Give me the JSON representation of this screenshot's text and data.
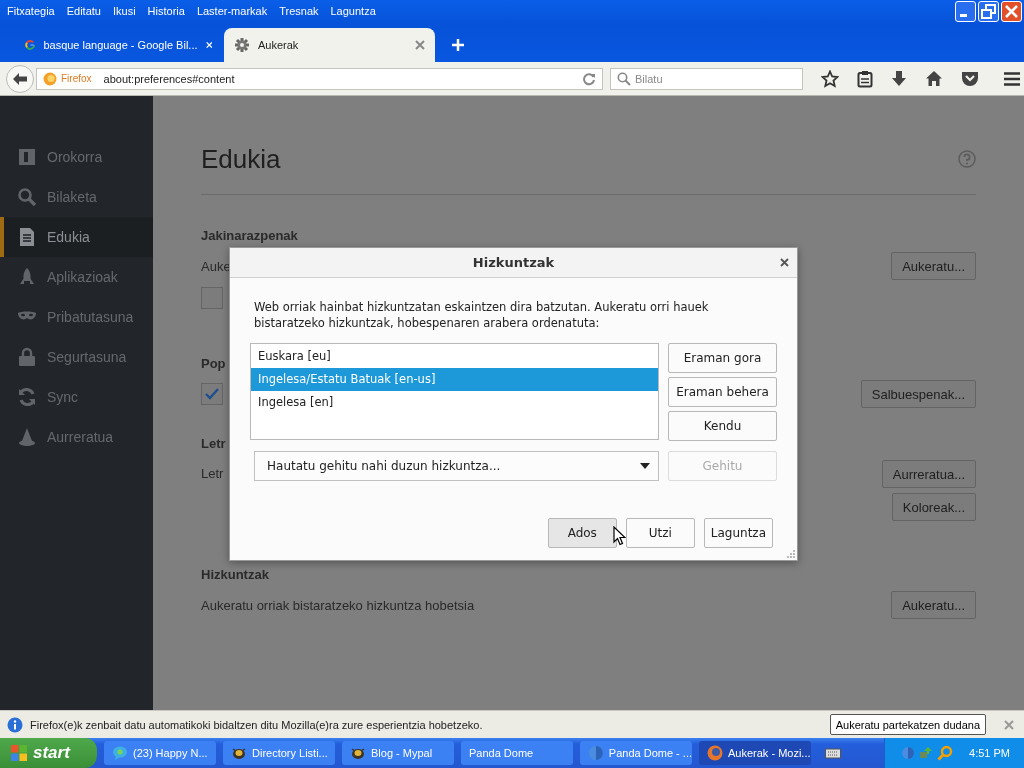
{
  "menu": [
    {
      "label": "Fitxategia"
    },
    {
      "label": "Editatu"
    },
    {
      "label": "Ikusi"
    },
    {
      "label": "Historia"
    },
    {
      "label": "Laster-markak"
    },
    {
      "label": "Tresnak"
    },
    {
      "label": "Laguntza"
    }
  ],
  "tabs": [
    {
      "title": "basque language - Google Bil...",
      "kind": "google",
      "selected": false
    },
    {
      "title": "Aukerak",
      "kind": "gear",
      "selected": true
    }
  ],
  "navbar": {
    "identity": "Firefox",
    "url": "about:preferences#content",
    "search_placeholder": "Bilatu"
  },
  "sidebar": [
    {
      "label": "Orokorra",
      "kind": "general",
      "selected": false
    },
    {
      "label": "Bilaketa",
      "kind": "search",
      "selected": false
    },
    {
      "label": "Edukia",
      "kind": "content",
      "selected": true
    },
    {
      "label": "Aplikazioak",
      "kind": "apps",
      "selected": false
    },
    {
      "label": "Pribatutasuna",
      "kind": "mask",
      "selected": false
    },
    {
      "label": "Segurtasuna",
      "kind": "lock",
      "selected": false
    },
    {
      "label": "Sync",
      "kind": "sync",
      "selected": false
    },
    {
      "label": "Aurreratua",
      "kind": "wizard",
      "selected": false
    }
  ],
  "page": {
    "title": "Edukia",
    "notifications": {
      "heading": "Jakinarazpenak",
      "text": "Auke",
      "button": "Aukeratu...",
      "checked": false
    },
    "popups": {
      "heading": "Pop",
      "checked": true,
      "button": "Salbuespenak..."
    },
    "fonts": {
      "heading": "Letr",
      "text": "Letr",
      "buttons": [
        "Aurreratua...",
        "Koloreak..."
      ]
    },
    "languages": {
      "heading": "Hizkuntzak",
      "text": "Aukeratu orriak bistaratzeko hizkuntza hobetsia",
      "button": "Aukeratu..."
    }
  },
  "dialog": {
    "title": "Hizkuntzak",
    "description": "Web orriak hainbat hizkuntzatan eskaintzen dira batzutan. Aukeratu orri hauek bistaratzeko hizkuntzak, hobespenaren arabera ordenatuta:",
    "languages": [
      {
        "label": "Euskara  [eu]",
        "selected": false
      },
      {
        "label": "Ingelesa/Estatu Batuak  [en-us]",
        "selected": true
      },
      {
        "label": "Ingelesa  [en]",
        "selected": false
      }
    ],
    "side_buttons": [
      "Eraman gora",
      "Eraman behera",
      "Kendu"
    ],
    "picker_placeholder": "Hautatu gehitu nahi duzun hizkuntza...",
    "add_button": {
      "label": "Gehitu",
      "disabled": true
    },
    "buttons": [
      {
        "label": "Ados",
        "hovered": true
      },
      {
        "label": "Utzi",
        "hovered": false
      },
      {
        "label": "Laguntza",
        "hovered": false
      }
    ]
  },
  "notification_bar": {
    "text": "Firefox(e)k zenbait datu automatikoki bidaltzen ditu Mozilla(e)ra zure esperientzia hobetzeko.",
    "button": "Aukeratu partekatzen dudana"
  },
  "taskbar": {
    "start": "start",
    "tasks": [
      {
        "label": "(23) Happy N...",
        "kind": "bubble",
        "active": false
      },
      {
        "label": "Directory Listi...",
        "kind": "critter",
        "active": false
      },
      {
        "label": "Blog - Mypal",
        "kind": "critter",
        "active": false
      },
      {
        "label": "Panda Dome",
        "kind": "plain",
        "active": false
      },
      {
        "label": "Panda Dome - ...",
        "kind": "globe",
        "active": false
      },
      {
        "label": "Aukerak - Mozi...",
        "kind": "firefox",
        "active": true
      }
    ],
    "clock": "4:51 PM"
  }
}
